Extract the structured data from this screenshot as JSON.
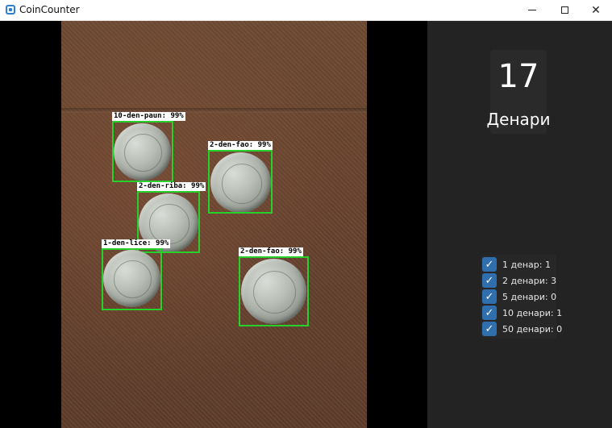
{
  "window": {
    "title": "CoinCounter",
    "minimize_glyph": "",
    "maximize_glyph": "",
    "close_glyph": "✕"
  },
  "detections": [
    {
      "label": "10-den-paun: 99%"
    },
    {
      "label": "2-den-fao: 99%"
    },
    {
      "label": "2-den-riba: 99%"
    },
    {
      "label": "1-den-lice: 99%"
    },
    {
      "label": "2-den-fao: 99%"
    }
  ],
  "summary": {
    "total": "17",
    "unit": "Денари"
  },
  "filters": [
    {
      "label": "1 денар: 1",
      "checked": true
    },
    {
      "label": "2 денари: 3",
      "checked": true
    },
    {
      "label": "5 денари: 0",
      "checked": true
    },
    {
      "label": "10 денари: 1",
      "checked": true
    },
    {
      "label": "50 денари: 0",
      "checked": true
    }
  ],
  "colors": {
    "detection_box": "#28d02c",
    "panel_bg": "#232323",
    "checkbox": "#2f6fae"
  }
}
